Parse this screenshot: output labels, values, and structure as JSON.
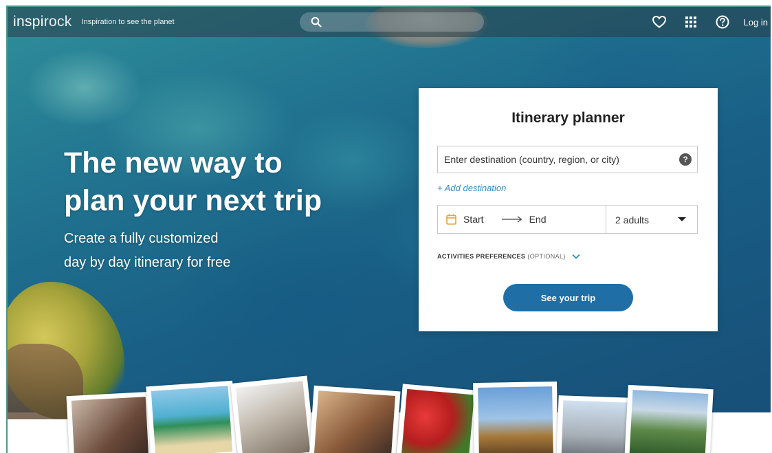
{
  "header": {
    "logo_bold": "inspi",
    "logo_light": "rock",
    "tagline": "Inspiration to see the planet",
    "login_label": "Log in",
    "icons": [
      "search-icon",
      "heart-icon",
      "grid-icon",
      "help-circle-icon"
    ]
  },
  "hero": {
    "headline_line1": "The new way to",
    "headline_line2": "plan your next trip",
    "sub_line1": "Create a fully customized",
    "sub_line2": "day by day itinerary for free"
  },
  "planner": {
    "title": "Itinerary planner",
    "destination_placeholder": "Enter destination (country, region, or city)",
    "help_label": "?",
    "add_destination": "+ Add destination",
    "start_label": "Start",
    "end_label": "End",
    "guests_value": "2 adults",
    "prefs_label": "ACTIVITIES PREFERENCES",
    "prefs_optional": "(OPTIONAL)",
    "cta_label": "See your trip"
  },
  "colors": {
    "accent": "#1f6fa6",
    "link": "#2f8dbf"
  },
  "photo_strip": [
    "friends-selfie",
    "tropical-beach",
    "statue-of-david",
    "selfie-people",
    "red-tulips",
    "eiffel-tower",
    "castle",
    "mountain-lake"
  ]
}
